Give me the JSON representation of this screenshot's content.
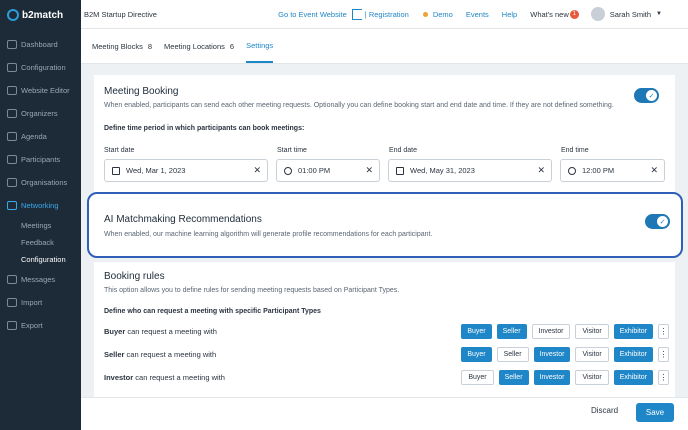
{
  "brand": {
    "name": "b2match"
  },
  "sidebar": {
    "items": [
      {
        "label": "Dashboard"
      },
      {
        "label": "Configuration"
      },
      {
        "label": "Website Editor"
      },
      {
        "label": "Organizers"
      },
      {
        "label": "Agenda"
      },
      {
        "label": "Participants"
      },
      {
        "label": "Organisations"
      },
      {
        "label": "Networking"
      }
    ],
    "sub_items": [
      {
        "label": "Meetings"
      },
      {
        "label": "Feedback"
      },
      {
        "label": "Configuration"
      }
    ],
    "bottom_items": [
      {
        "label": "Messages"
      },
      {
        "label": "Import"
      },
      {
        "label": "Export"
      }
    ]
  },
  "topbar": {
    "event_name": "B2M Startup Directive",
    "go_to_event": "Go to Event Website",
    "registration": "| Registration",
    "demo": "Demo",
    "events": "Events",
    "help": "Help",
    "whats_new": "What's new",
    "whats_new_count": "1",
    "user_name": "Sarah Smith"
  },
  "tabs": [
    {
      "label": "Meeting Blocks",
      "count": "8"
    },
    {
      "label": "Meeting Locations",
      "count": "6"
    },
    {
      "label": "Settings",
      "count": ""
    }
  ],
  "meeting_booking": {
    "title": "Meeting Booking",
    "description": "When enabled, participants can send each other meeting requests. Optionally you can define booking start and end date and time. If they are not defined something.",
    "period_label": "Define time period in which participants can book meetings:",
    "start_date_label": "Start date",
    "start_date": "Wed, Mar 1, 2023",
    "start_time_label": "Start time",
    "start_time": "01:00 PM",
    "end_date_label": "End date",
    "end_date": "Wed, May 31, 2023",
    "end_time_label": "End time",
    "end_time": "12:00 PM",
    "enabled": true
  },
  "ai_matchmaking": {
    "title": "AI Matchmaking Recommendations",
    "description": "When enabled, our machine learning algorithm will generate profile recommendations for each participant.",
    "enabled": true
  },
  "booking_rules": {
    "title": "Booking rules",
    "description": "This option allows you to define rules for sending meeting requests based on Participant Types.",
    "subheading": "Define who can request a meeting with specific Participant Types",
    "chip_labels": [
      "Buyer",
      "Seller",
      "Investor",
      "Visitor",
      "Exhibitor"
    ],
    "rows": [
      {
        "type": "Buyer",
        "text": " can request a meeting with",
        "active": [
          true,
          true,
          false,
          false,
          true
        ]
      },
      {
        "type": "Seller",
        "text": " can request a meeting with",
        "active": [
          true,
          false,
          true,
          false,
          true
        ]
      },
      {
        "type": "Investor",
        "text": " can request a meeting with",
        "active": [
          false,
          true,
          true,
          false,
          true
        ]
      }
    ]
  },
  "footer": {
    "discard": "Discard",
    "save": "Save"
  },
  "colors": {
    "accent": "#1f86c7",
    "sidebar": "#1d2b38",
    "highlight_border": "#2f5fb8"
  }
}
